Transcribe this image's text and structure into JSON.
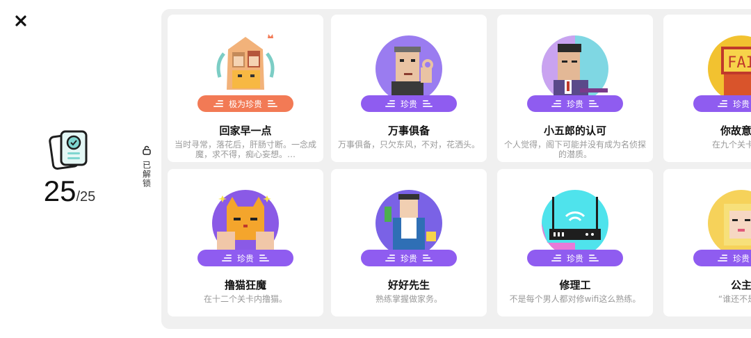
{
  "header": {
    "close_icon": "close-icon"
  },
  "summary": {
    "unlocked": "25",
    "total": "/25",
    "icon": "badge-certificate-icon"
  },
  "tab": {
    "label": "已解锁",
    "icon": "unlock-icon"
  },
  "colors": {
    "purple_pill": "#8f5cf0",
    "orange_pill": "#f27a55",
    "grid_bg": "#f0f0f0"
  },
  "cards": [
    {
      "rarity": "极为珍贵",
      "title": "回家早一点",
      "desc": "当时寻常，落花后，肝肠寸断。一念成魔，求不得，痴心妄想。…",
      "icon": "family-pixel-icon"
    },
    {
      "rarity": "珍贵",
      "title": "万事俱备",
      "desc": "万事俱备，只欠东风，不对，花洒头。",
      "icon": "ok-hand-man-icon"
    },
    {
      "rarity": "珍贵",
      "title": "小五郎的认可",
      "desc": "个人觉得，阁下可能并没有成为名侦探的潜质。",
      "icon": "detective-icon"
    },
    {
      "rarity": "珍贵",
      "title": "你故意的",
      "desc": "在九个关卡中触",
      "icon": "sign-icon"
    },
    {
      "rarity": "珍贵",
      "title": "撸猫狂魔",
      "desc": "在十二个关卡内撸猫。",
      "icon": "cat-icon"
    },
    {
      "rarity": "珍贵",
      "title": "好好先生",
      "desc": "熟练掌握做家务。",
      "icon": "housework-man-icon"
    },
    {
      "rarity": "珍贵",
      "title": "修理工",
      "desc": "不是每个男人都对修wifi这么熟练。",
      "icon": "router-icon"
    },
    {
      "rarity": "珍贵",
      "title": "公主",
      "desc": "“谁还不是个",
      "icon": "princess-icon"
    }
  ]
}
